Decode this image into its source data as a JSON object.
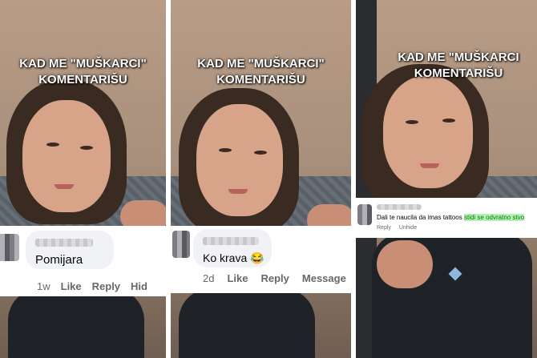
{
  "panels": [
    {
      "title_line1": "KAD ME \"MUŠKARCI\"",
      "title_line2": "KOMENTARIŠU",
      "comment": {
        "text": "Pomijara",
        "time": "1w",
        "like": "Like",
        "reply": "Reply",
        "hide": "Hid"
      }
    },
    {
      "title_line1": "KAD ME \"MUŠKARCI\"",
      "title_line2": "KOMENTARIŠU",
      "comment": {
        "text": "Ko krava",
        "emoji": "😂",
        "time": "2d",
        "like": "Like",
        "reply": "Reply",
        "message": "Message"
      }
    },
    {
      "title_line1": "KAD ME \"MUŠKARCI",
      "title_line2": "KOMENTARIŠU",
      "comment": {
        "text": "Dali te naucila da imas tattoos",
        "highlight": "stidi se odvratno stvo",
        "reply": "Reply",
        "unhide": "Unhide"
      }
    }
  ],
  "colors": {
    "highlight_bg": "#b6f0b6",
    "highlight_text": "#0a7a0a",
    "action_text": "#65676b",
    "bubble_bg": "#f0f2f5"
  }
}
